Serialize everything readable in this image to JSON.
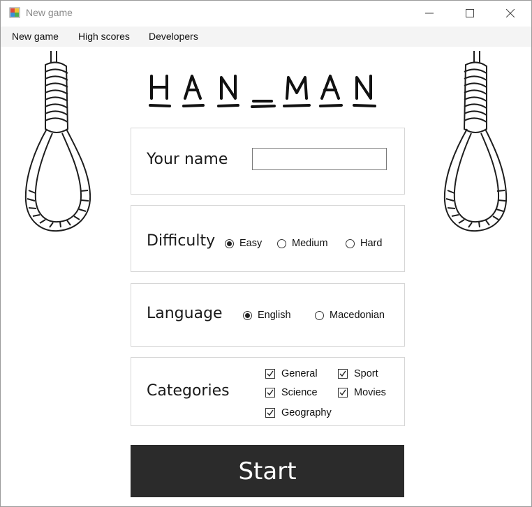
{
  "window": {
    "title": "New game",
    "minimize_glyph": "—",
    "maximize_glyph": "☐",
    "close_glyph": "✕"
  },
  "menu": {
    "items": [
      "New game",
      "High scores",
      "Developers"
    ]
  },
  "logo": {
    "text": "HAN_MAN"
  },
  "name_section": {
    "label": "Your name",
    "value": "",
    "placeholder": ""
  },
  "difficulty": {
    "label": "Difficulty",
    "options": [
      {
        "label": "Easy",
        "selected": true
      },
      {
        "label": "Medium",
        "selected": false
      },
      {
        "label": "Hard",
        "selected": false
      }
    ]
  },
  "language": {
    "label": "Language",
    "options": [
      {
        "label": "English",
        "selected": true
      },
      {
        "label": "Macedonian",
        "selected": false
      }
    ]
  },
  "categories": {
    "label": "Categories",
    "items": [
      {
        "label": "General",
        "checked": true
      },
      {
        "label": "Sport",
        "checked": true
      },
      {
        "label": "Science",
        "checked": true
      },
      {
        "label": "Movies",
        "checked": true
      },
      {
        "label": "Geography",
        "checked": true
      }
    ]
  },
  "start_button": {
    "label": "Start"
  },
  "colors": {
    "button_bg": "#2b2b2b",
    "button_text": "#ffffff",
    "panel_border": "#d6d6d6"
  },
  "icons": {
    "app": "app-window-icon",
    "noose": "noose-icon",
    "check": "checkmark-icon",
    "radio": "radio-dot-icon"
  }
}
